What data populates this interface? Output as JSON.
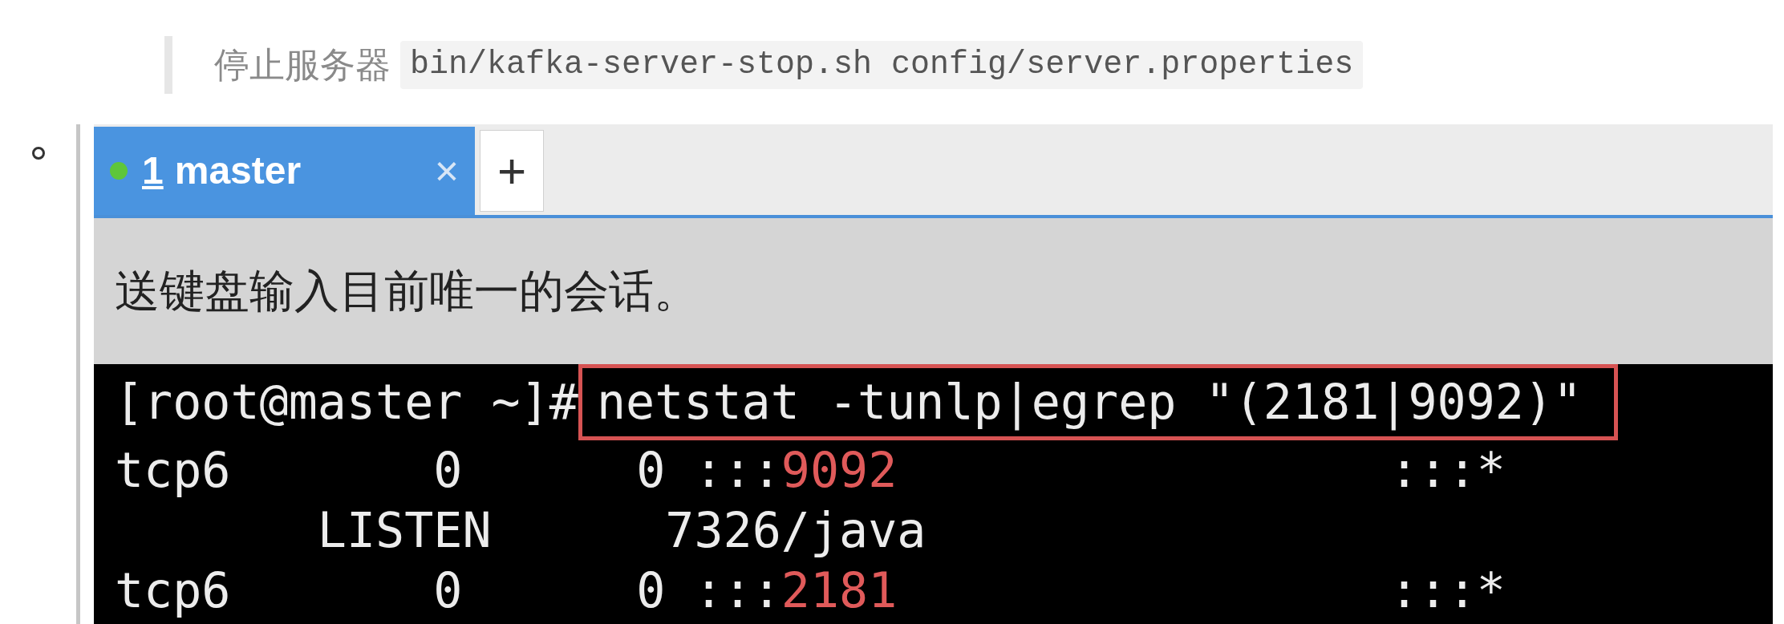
{
  "note": {
    "label": "停止服务器",
    "code": "bin/kafka-server-stop.sh config/server.properties"
  },
  "terminal_window": {
    "tabs": [
      {
        "number": "1",
        "label": "master",
        "selected": true,
        "color": "#5ec63a",
        "close": "×"
      }
    ],
    "new_tab": "+",
    "broadcast_notice": "送键盘输入目前唯一的会话。",
    "command_line": {
      "prompt": "[root@master ~]#",
      "command": "netstat -tunlp|egrep \"(2181|9092)\"",
      "highlighted": true
    },
    "output_lines": [
      [
        {
          "kind": "plain",
          "text": "tcp6       0      0 :::"
        },
        {
          "kind": "port",
          "text": "9092"
        },
        {
          "kind": "plain",
          "text": "                 :::*"
        }
      ],
      [
        {
          "kind": "plain",
          "text": "       LISTEN      7326/java"
        }
      ],
      [
        {
          "kind": "plain",
          "text": "tcp6       0      0 :::"
        },
        {
          "kind": "port",
          "text": "2181"
        },
        {
          "kind": "plain",
          "text": "                 :::*"
        }
      ]
    ]
  }
}
